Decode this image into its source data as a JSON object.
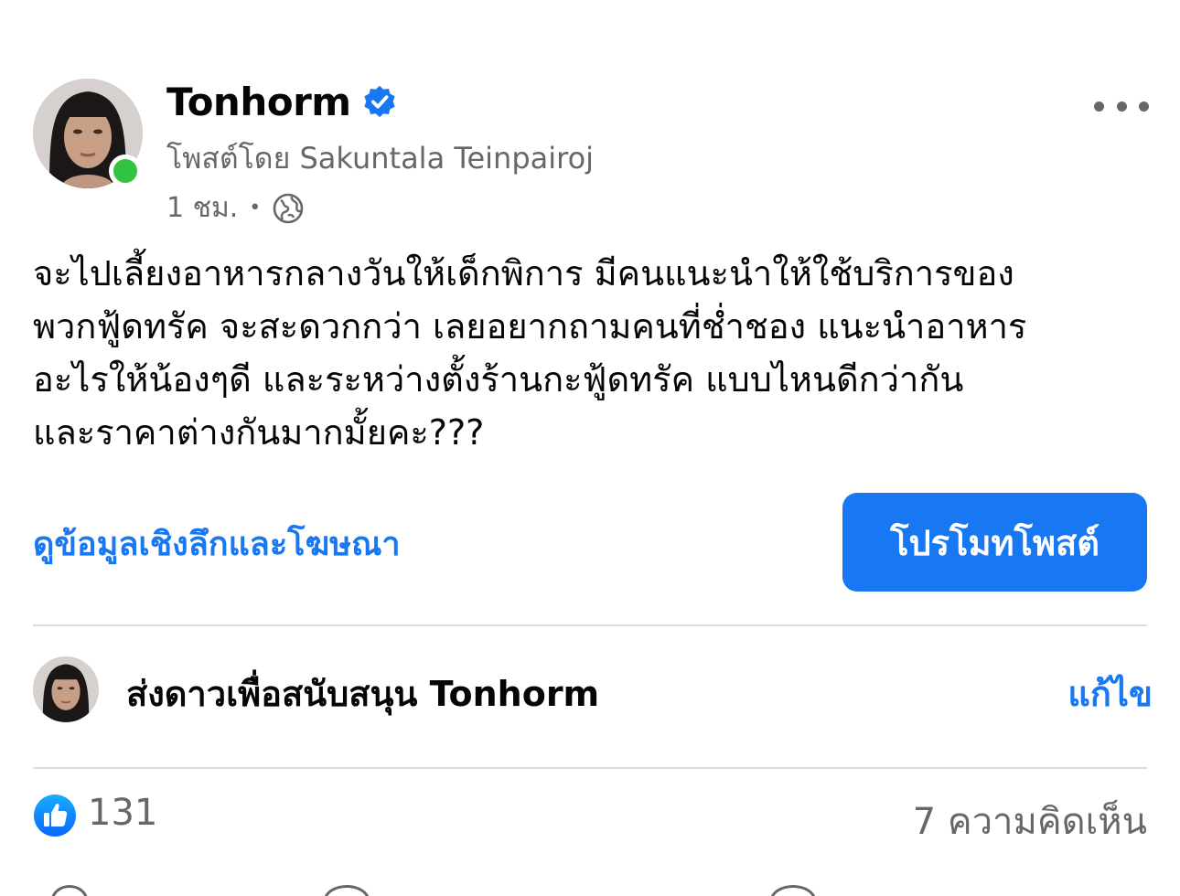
{
  "post": {
    "author": "Tonhorm",
    "posted_by": "โพสต์โดย Sakuntala Teinpairoj",
    "time": "1 ชม.",
    "separator": "•",
    "text": "จะไปเลี้ยงอาหารกลางวันให้เด็กพิการ มีคนแนะนำให้ใช้บริการของ\nพวกฟู้ดทรัค จะสะดวกกว่า เลยอยากถามคนที่ช่ำชอง แนะนำอาหาร\nอะไรให้น้องๆดี และระหว่างตั้งร้านกะฟู้ดทรัค แบบไหนดีกว่ากัน\nและราคาต่างกันมากมั้ยคะ???"
  },
  "actions": {
    "insights_label": "ดูข้อมูลเชิงลึกและโฆษณา",
    "promote_label": "โปรโมทโพสต์"
  },
  "stars": {
    "label": "ส่งดาวเพื่อสนับสนุน Tonhorm",
    "edit_label": "แก้ไข"
  },
  "reactions": {
    "likes": "131",
    "comments": "7 ความคิดเห็น"
  },
  "icons": {
    "verified": "verified-badge-icon",
    "audience": "globe-icon",
    "more": "more-horizontal-icon",
    "like": "like-icon"
  },
  "colors": {
    "accent": "#1877f2",
    "online": "#31c443",
    "secondary_text": "#65676b",
    "divider": "#dadde1"
  }
}
